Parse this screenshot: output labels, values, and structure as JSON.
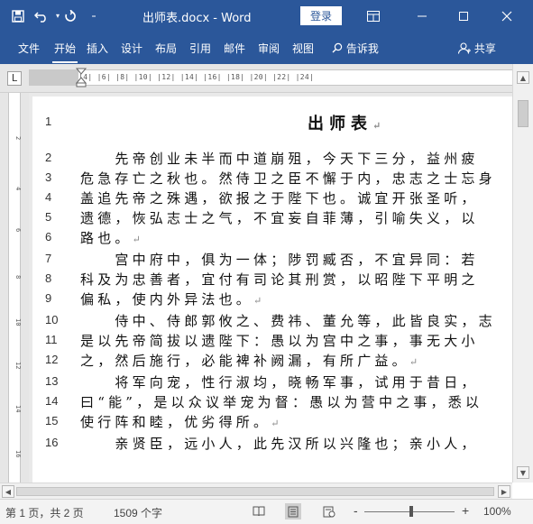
{
  "titlebar": {
    "save_icon": "save-icon",
    "undo_icon": "undo-icon",
    "redo_icon": "redo-icon",
    "qa_icon": "customize-qat-icon",
    "title": "出师表.docx - Word",
    "login": "登录",
    "ribbon_display_icon": "ribbon-display-icon",
    "minimize_icon": "minimize-icon",
    "maximize_icon": "maximize-icon",
    "close_icon": "close-icon"
  },
  "tabs": [
    "文件",
    "开始",
    "插入",
    "设计",
    "布局",
    "引用",
    "邮件",
    "审阅",
    "视图"
  ],
  "tell_me": "告诉我",
  "share": "共享",
  "ruler": {
    "tab_selector": "L",
    "marks": "|2|   |  |2|  |4|  |6|  |8|  |10|  |12|  |14|  |16|  |18|  |20|  |22|  |24|"
  },
  "vruler": [
    "2",
    "4",
    "6",
    "8",
    "10",
    "12",
    "14",
    "16"
  ],
  "document": {
    "lines": [
      {
        "num": "1",
        "text": "出师表"
      },
      {
        "num": "2",
        "text": "　　先帝创业未半而中道崩殂，今天下三分，益州疲"
      },
      {
        "num": "3",
        "text": "危急存亡之秋也。然侍卫之臣不懈于内，忠志之士忘身"
      },
      {
        "num": "4",
        "text": "盖追先帝之殊遇，欲报之于陛下也。诚宜开张圣听，"
      },
      {
        "num": "5",
        "text": "遗德，恢弘志士之气，不宜妄自菲薄，引喻失义，以"
      },
      {
        "num": "6",
        "text": "路也。"
      },
      {
        "num": "7",
        "text": "　　宫中府中，俱为一体；陟罚臧否，不宜异同：若"
      },
      {
        "num": "8",
        "text": "科及为忠善者，宜付有司论其刑赏，以昭陛下平明之"
      },
      {
        "num": "9",
        "text": "偏私，使内外异法也。"
      },
      {
        "num": "10",
        "text": "　　侍中、侍郎郭攸之、费祎、董允等，此皆良实，志"
      },
      {
        "num": "11",
        "text": "是以先帝简拔以遗陛下：愚以为宫中之事，事无大小"
      },
      {
        "num": "12",
        "text": "之，然后施行，必能裨补阙漏，有所广益。"
      },
      {
        "num": "13",
        "text": "　　将军向宠，性行淑均，晓畅军事，试用于昔日，"
      },
      {
        "num": "14",
        "text": "曰“能”，是以众议举宠为督：愚以为营中之事，悉以"
      },
      {
        "num": "15",
        "text": "使行阵和睦，优劣得所。"
      },
      {
        "num": "16",
        "text": "　　亲贤臣，远小人，此先汉所以兴隆也；亲小人，"
      }
    ]
  },
  "statusbar": {
    "page": "第 1 页，共 2 页",
    "words": "1509 个字",
    "zoom": "100%",
    "zoom_minus": "-",
    "zoom_plus": "+"
  }
}
